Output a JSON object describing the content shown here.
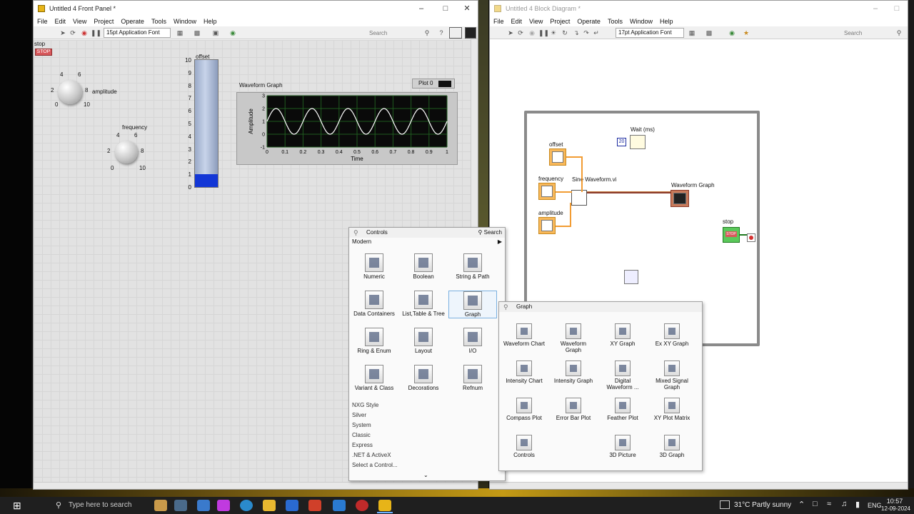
{
  "front_panel": {
    "title": "Untitled 4 Front Panel *",
    "menu": [
      "File",
      "Edit",
      "View",
      "Project",
      "Operate",
      "Tools",
      "Window",
      "Help"
    ],
    "font": "15pt Application Font",
    "search_placeholder": "Search",
    "stop_label": "stop",
    "stop_button": "STOP",
    "amplitude_label": "amplitude",
    "frequency_label": "frequency",
    "knob_ticks": [
      "0",
      "2",
      "4",
      "6",
      "8",
      "10"
    ],
    "offset_label": "offset",
    "offset_scale": [
      "10",
      "9",
      "8",
      "7",
      "6",
      "5",
      "4",
      "3",
      "2",
      "1",
      "0"
    ],
    "offset_fraction": 0.1,
    "graph_title": "Waveform Graph",
    "legend": "Plot 0"
  },
  "chart_data": {
    "type": "line",
    "title": "Waveform Graph",
    "xlabel": "Time",
    "ylabel": "Amplitude",
    "xlim": [
      0,
      1
    ],
    "ylim": [
      -1,
      3
    ],
    "x_ticks": [
      "0",
      "0.1",
      "0.2",
      "0.3",
      "0.4",
      "0.5",
      "0.6",
      "0.7",
      "0.8",
      "0.9",
      "1"
    ],
    "y_ticks": [
      "3",
      "2",
      "1",
      "0",
      "-1"
    ],
    "series": [
      {
        "name": "Plot 0",
        "offset": 1,
        "amplitude": 1,
        "cycles": 5
      }
    ],
    "grid": true,
    "colors": {
      "background": "#0a0a0a",
      "grid": "#1f5a1f",
      "line": "#ffffff"
    }
  },
  "block_diagram": {
    "title": "Untitled 4 Block Diagram *",
    "menu": [
      "File",
      "Edit",
      "View",
      "Project",
      "Operate",
      "Tools",
      "Window",
      "Help"
    ],
    "font": "17pt Application Font",
    "search_placeholder": "Search",
    "nodes": {
      "offset": "offset",
      "frequency": "frequency",
      "amplitude": "amplitude",
      "sine": "Sine Waveform.vi",
      "graph": "Waveform Graph",
      "wait": "Wait (ms)",
      "wait_const": "20",
      "stop": "stop",
      "stop_btn": "STOP"
    }
  },
  "controls_palette": {
    "title": "Controls",
    "search": "Search",
    "section": "Modern",
    "items": [
      "Numeric",
      "Boolean",
      "String & Path",
      "Data Containers",
      "List,Table & Tree",
      "Graph",
      "Ring & Enum",
      "Layout",
      "I/O",
      "Variant & Class",
      "Decorations",
      "Refnum"
    ],
    "categories": [
      "NXG Style",
      "Silver",
      "System",
      "Classic",
      "Express",
      ".NET & ActiveX",
      "Select a Control..."
    ]
  },
  "graph_palette": {
    "title": "Graph",
    "items": [
      [
        "Waveform Chart",
        ""
      ],
      [
        "Waveform",
        "Graph"
      ],
      [
        "XY Graph",
        ""
      ],
      [
        "Ex XY Graph",
        ""
      ],
      [
        "Intensity Chart",
        ""
      ],
      [
        "Intensity Graph",
        ""
      ],
      [
        "Digital",
        "Waveform ..."
      ],
      [
        "Mixed Signal",
        "Graph"
      ],
      [
        "Compass Plot",
        ""
      ],
      [
        "Error Bar Plot",
        ""
      ],
      [
        "Feather Plot",
        ""
      ],
      [
        "XY Plot Matrix",
        ""
      ],
      [
        "Controls",
        ""
      ],
      [
        "",
        ""
      ],
      [
        "3D Picture",
        ""
      ],
      [
        "3D Graph",
        ""
      ]
    ]
  },
  "taskbar": {
    "search_placeholder": "Type here to search",
    "weather": "31°C  Partly sunny",
    "lang": "ENG",
    "time": "10:57",
    "date": "12-09-2024"
  }
}
